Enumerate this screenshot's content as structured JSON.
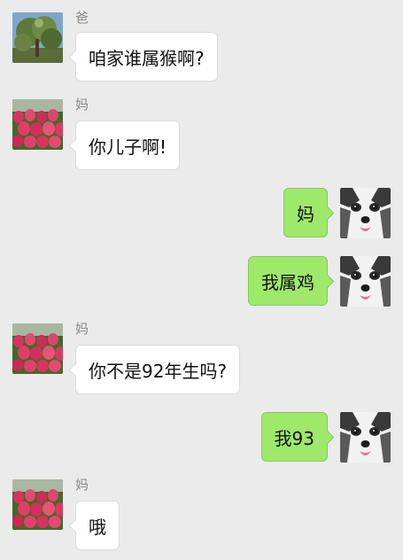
{
  "colors": {
    "background": "#ebebeb",
    "bubble_in": "#ffffff",
    "bubble_out": "#9ee86a"
  },
  "messages": [
    {
      "sender": "爸",
      "text": "咱家谁属猴啊?",
      "direction": "in",
      "avatar": "tree-photo"
    },
    {
      "sender": "妈",
      "text": "你儿子啊!",
      "direction": "in",
      "avatar": "tulip-photo"
    },
    {
      "sender": "",
      "text": "妈",
      "direction": "out",
      "avatar": "husky-dog-photo"
    },
    {
      "sender": "",
      "text": "我属鸡",
      "direction": "out",
      "avatar": "husky-dog-photo"
    },
    {
      "sender": "妈",
      "text": "你不是92年生吗?",
      "direction": "in",
      "avatar": "tulip-photo"
    },
    {
      "sender": "",
      "text": "我93",
      "direction": "out",
      "avatar": "husky-dog-photo"
    },
    {
      "sender": "妈",
      "text": "哦",
      "direction": "in",
      "avatar": "tulip-photo"
    }
  ]
}
